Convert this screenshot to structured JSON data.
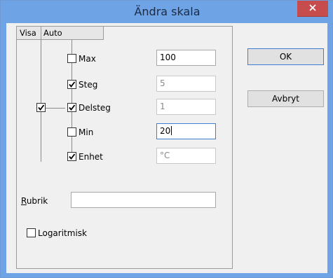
{
  "window": {
    "title": "Ändra skala"
  },
  "columns": {
    "visa": "Visa",
    "auto": "Auto"
  },
  "rows": [
    {
      "label": "Max",
      "checked": false,
      "value": "100",
      "enabled": true
    },
    {
      "label": "Steg",
      "checked": true,
      "value": "5",
      "enabled": false
    },
    {
      "label": "Delsteg",
      "checked": true,
      "value": "1",
      "enabled": false
    },
    {
      "label": "Min",
      "checked": false,
      "value": "20",
      "enabled": true
    },
    {
      "label": "Enhet",
      "checked": true,
      "value": "°C",
      "enabled": false
    }
  ],
  "visa_checkbox": {
    "checked": true
  },
  "rubrik": {
    "label": "Rubrik",
    "mnemonic": "R",
    "rest": "ubrik",
    "value": ""
  },
  "logaritmisk": {
    "label": "Logaritmisk",
    "checked": false
  },
  "buttons": {
    "ok": "OK",
    "cancel": "Avbryt"
  }
}
